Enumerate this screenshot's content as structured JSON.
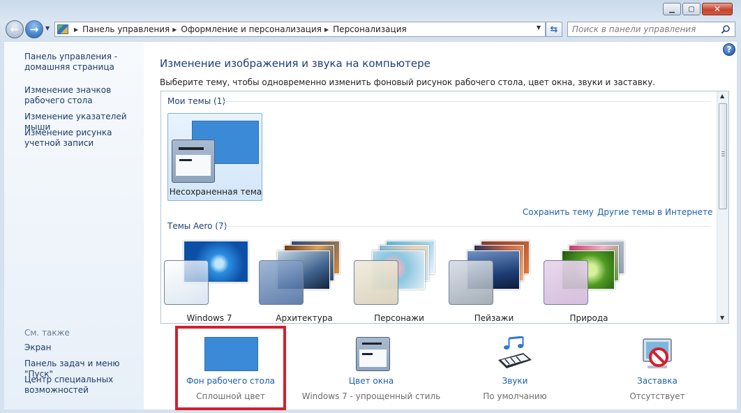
{
  "window": {
    "caption_minimize": "▁",
    "caption_maximize": "▢",
    "caption_close": "✕"
  },
  "address_bar": {
    "crumbs": [
      "Панель управления",
      "Оформление и персонализация",
      "Персонализация"
    ]
  },
  "search": {
    "placeholder": "Поиск в панели управления"
  },
  "sidebar": {
    "home_link": "Панель управления - домашняя страница",
    "links": [
      "Изменение значков рабочего стола",
      "Изменение указателей мыши",
      "Изменение рисунка учетной записи"
    ],
    "see_also_title": "См. также",
    "see_also_links": [
      "Экран",
      "Панель задач и меню \"Пуск\"",
      "Центр специальных возможностей"
    ]
  },
  "main": {
    "heading": "Изменение изображения и звука на компьютере",
    "subheading": "Выберите тему, чтобы одновременно изменить фоновый рисунок рабочего стола, цвет окна, звуки и заставку.",
    "my_themes_title": "Мои темы (1)",
    "my_theme_label": "Несохраненная тема",
    "save_theme_link": "Сохранить тему",
    "online_themes_link": "Другие темы в Интернете",
    "aero_title": "Темы Aero (7)",
    "aero_themes": [
      "Windows 7",
      "Архитектура",
      "Персонажи",
      "Пейзажи",
      "Природа"
    ]
  },
  "settings": [
    {
      "name": "Фон рабочего стола",
      "value": "Сплошной цвет",
      "icon": "desktop-background-icon"
    },
    {
      "name": "Цвет окна",
      "value": "Windows 7 - упрощенный стиль",
      "icon": "window-color-icon"
    },
    {
      "name": "Звуки",
      "value": "По умолчанию",
      "icon": "sounds-icon"
    },
    {
      "name": "Заставка",
      "value": "Отсутствует",
      "icon": "screensaver-icon"
    }
  ],
  "colors": {
    "accent_blue": "#3b8ad7",
    "highlight_red": "#d3202e",
    "link_blue": "#1d5fa8",
    "heading_blue": "#1e3f77"
  }
}
